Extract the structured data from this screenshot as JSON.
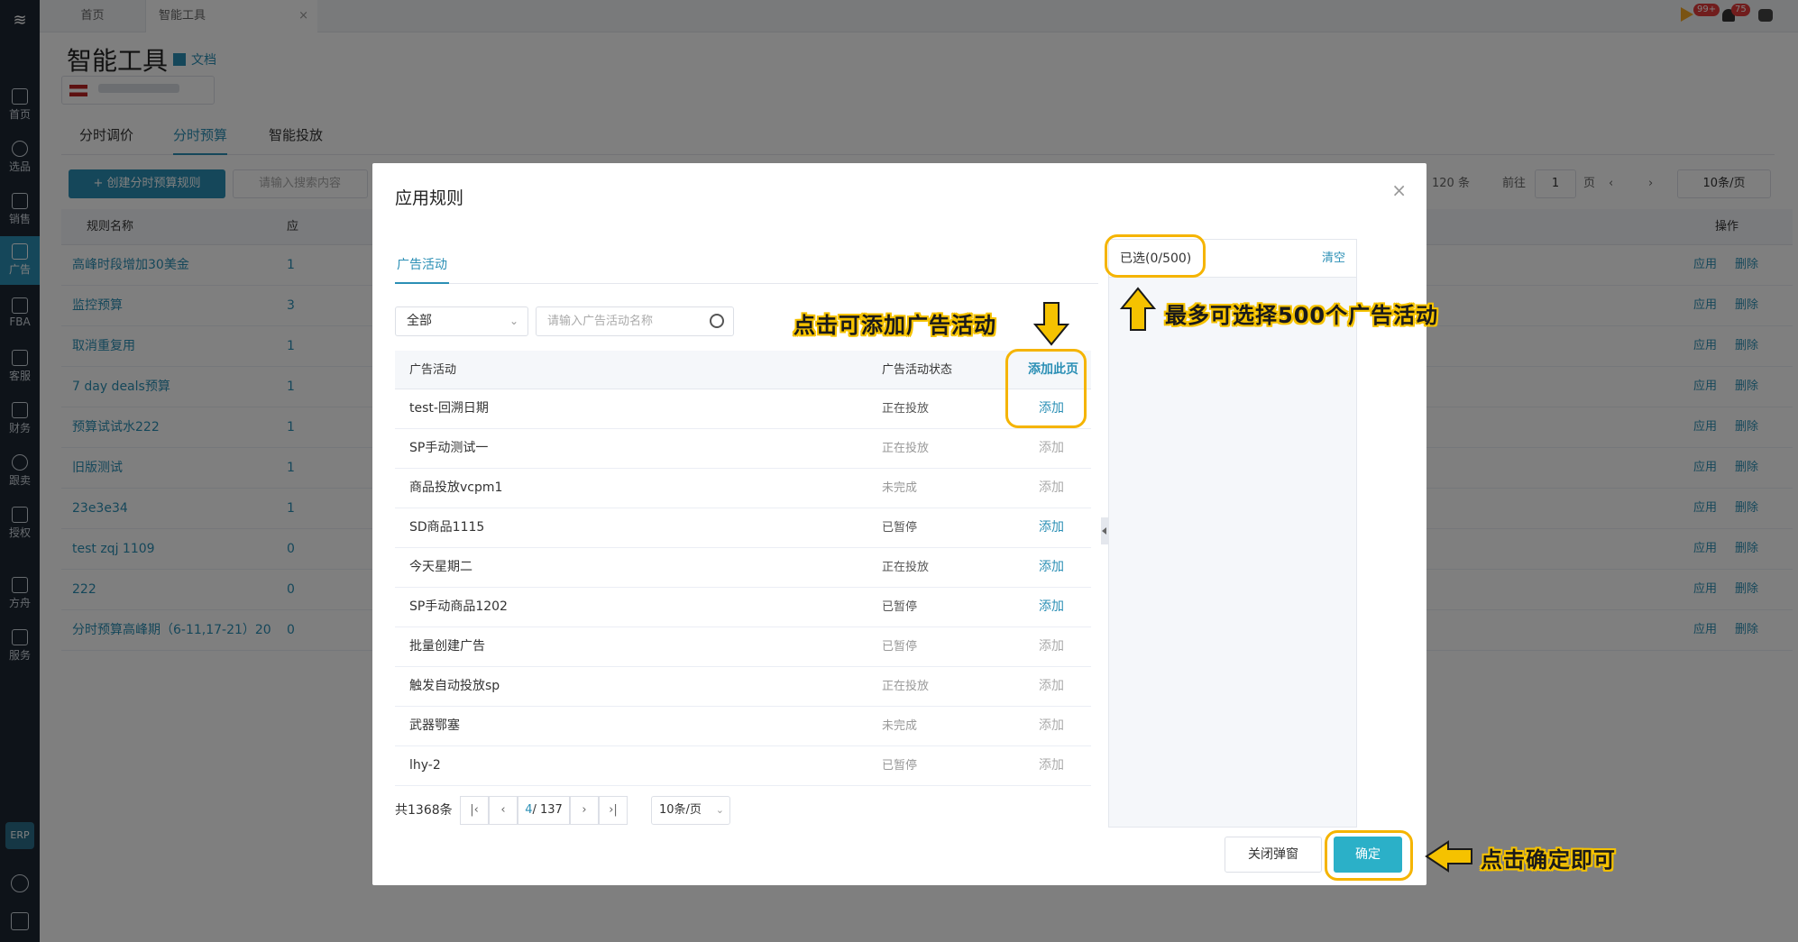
{
  "sidebar": {
    "items": [
      {
        "label": "首页",
        "icon": "home-icon"
      },
      {
        "label": "选品",
        "icon": "search-icon"
      },
      {
        "label": "销售",
        "icon": "chart-icon"
      },
      {
        "label": "广告",
        "icon": "ad-icon"
      },
      {
        "label": "FBA",
        "icon": "box-icon"
      },
      {
        "label": "客服",
        "icon": "service-icon"
      },
      {
        "label": "财务",
        "icon": "dollar-icon"
      },
      {
        "label": "跟卖",
        "icon": "pie-icon"
      },
      {
        "label": "授权",
        "icon": "shield-icon"
      },
      {
        "label": "方舟",
        "icon": "ark-icon"
      },
      {
        "label": "服务",
        "icon": "briefcase-icon"
      }
    ],
    "erp": "ERP"
  },
  "topbar": {
    "tabs": [
      "首页",
      "智能工具"
    ],
    "badge_messages": "99+",
    "badge_notifications": "75"
  },
  "page": {
    "title": "智能工具",
    "doc_link": "文档",
    "tabs": [
      "分时调价",
      "分时预算",
      "智能投放"
    ],
    "create_button": "+ 创建分时预算规则",
    "search_placeholder": "请输入搜索内容",
    "total_text": "120 条",
    "goto_label": "前往",
    "goto_value": "1",
    "page_suffix": "页",
    "page_size": "10条/页",
    "columns": {
      "name": "规则名称",
      "apply": "应",
      "ops": "操作"
    },
    "rules": [
      {
        "name": "高峰时段增加30美金",
        "num": "1"
      },
      {
        "name": "监控预算",
        "num": "3"
      },
      {
        "name": "取消重复用",
        "num": "1"
      },
      {
        "name": "7 day deals预算",
        "num": "1"
      },
      {
        "name": "预算试试水222",
        "num": "1"
      },
      {
        "name": "旧版测试",
        "num": "1"
      },
      {
        "name": "23e3e34",
        "num": "1"
      },
      {
        "name": "test zqj 1109",
        "num": "0"
      },
      {
        "name": "222",
        "num": "0"
      },
      {
        "name": "分时预算高峰期（6-11,17-21）20",
        "num": "0"
      }
    ],
    "row_apply": "应用",
    "row_delete": "删除"
  },
  "modal": {
    "title": "应用规则",
    "tab": "广告活动",
    "filter_select": "全部",
    "search_placeholder": "请输入广告活动名称",
    "columns": {
      "name": "广告活动",
      "status": "广告活动状态",
      "add_page": "添加此页"
    },
    "rows": [
      {
        "name": "test-回溯日期",
        "status": "正在投放",
        "add": "添加",
        "enabled": true,
        "muted": false
      },
      {
        "name": "SP手动测试一",
        "status": "正在投放",
        "add": "添加",
        "enabled": false,
        "muted": true
      },
      {
        "name": "商品投放vcpm1",
        "status": "未完成",
        "add": "添加",
        "enabled": false,
        "muted": true
      },
      {
        "name": "SD商品1115",
        "status": "已暂停",
        "add": "添加",
        "enabled": true,
        "muted": false
      },
      {
        "name": "今天星期二",
        "status": "正在投放",
        "add": "添加",
        "enabled": true,
        "muted": false
      },
      {
        "name": "SP手动商品1202",
        "status": "已暂停",
        "add": "添加",
        "enabled": true,
        "muted": false
      },
      {
        "name": "批量创建广告",
        "status": "已暂停",
        "add": "添加",
        "enabled": false,
        "muted": true
      },
      {
        "name": "触发自动投放sp",
        "status": "正在投放",
        "add": "添加",
        "enabled": false,
        "muted": true
      },
      {
        "name": "武器鄂塞",
        "status": "未完成",
        "add": "添加",
        "enabled": false,
        "muted": true
      },
      {
        "name": "lhy-2",
        "status": "已暂停",
        "add": "添加",
        "enabled": false,
        "muted": true
      }
    ],
    "pager": {
      "total": "共1368条",
      "current": "4",
      "total_pages": "/ 137",
      "page_size": "10条/页"
    },
    "selected": {
      "title": "已选(0/500)",
      "clear": "清空"
    },
    "close_button": "关闭弹窗",
    "ok_button": "确定"
  },
  "annotations": {
    "add_hint": "点击可添加广告活动",
    "max_hint": "最多可选择500个广告活动",
    "confirm_hint": "点击确定即可",
    "highlight_color": "#f5b400"
  }
}
